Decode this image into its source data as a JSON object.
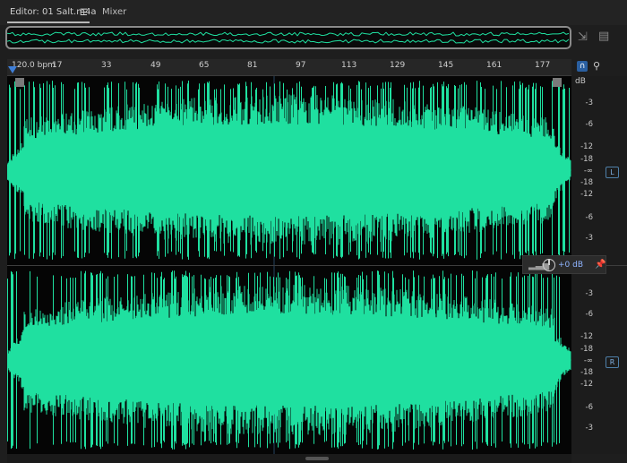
{
  "tabs": {
    "editor": "Editor: 01 Salt.m4a",
    "mixer": "Mixer"
  },
  "ruler": {
    "bpm": "120.0 bpm",
    "ticks": [
      "17",
      "33",
      "49",
      "65",
      "81",
      "97",
      "113",
      "129",
      "145",
      "161",
      "177"
    ]
  },
  "db_scale": {
    "unit": "dB",
    "top_channel": [
      "-3",
      "-6",
      "-12",
      "-18",
      "-∞",
      "-18",
      "-12",
      "-6",
      "-3"
    ],
    "bottom_channel": [
      "-3",
      "-6",
      "-12",
      "-18",
      "-∞",
      "-18",
      "-12",
      "-6",
      "-3"
    ],
    "left_label": "L",
    "right_label": "R"
  },
  "volume": {
    "value": "+0 dB"
  },
  "colors": {
    "waveform": "#1fe0a0",
    "background": "#050505",
    "playhead": "#3f7fd8"
  },
  "icons": {
    "menu": "hamburger-menu-icon",
    "zoom": "zoom-icon",
    "panel": "panel-icon",
    "snap": "magnet-icon",
    "marker": "marker-pin-icon",
    "volume_meter": "signal-bars-icon",
    "volume_knob": "knob-icon",
    "pin": "pin-icon"
  }
}
